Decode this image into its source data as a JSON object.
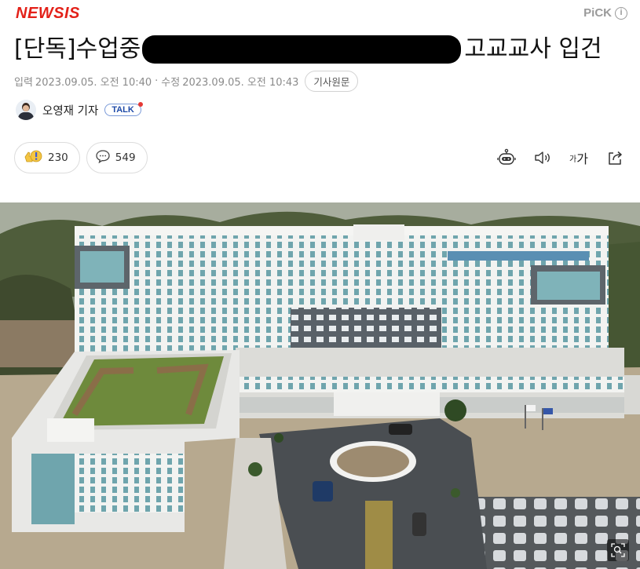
{
  "header": {
    "logo": "NEWSIS",
    "pick_label": "PiCK",
    "pick_info_glyph": "i",
    "logo_color": "#e32119"
  },
  "article": {
    "headline_prefix": "[단독]수업중",
    "headline_suffix": "고교교사 입건",
    "meta": {
      "input_label": "입력",
      "input_time": "2023.09.05. 오전 10:40",
      "separator": "·",
      "update_label": "수정",
      "update_time": "2023.09.05. 오전 10:43",
      "original_button": "기사원문"
    },
    "reporter": {
      "name": "오영재 기자",
      "talk_label": "TALK"
    },
    "reactions": {
      "like_count": "230",
      "comment_count": "549"
    },
    "tools": {
      "font_size_small": "가",
      "font_size_large": "가"
    }
  },
  "photo": {
    "subject": "aerial view of a multi-story white institutional building with rooftop garden, roundabout and parking lot"
  }
}
